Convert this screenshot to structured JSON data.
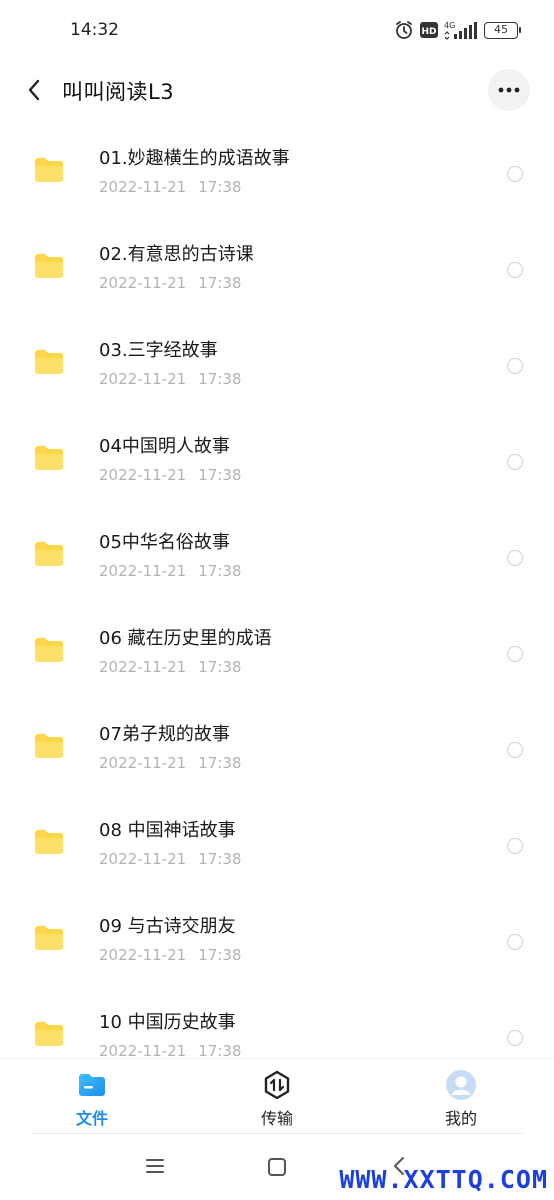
{
  "status_bar": {
    "time": "14:32",
    "network": "4G",
    "hd": "HD",
    "battery": "45"
  },
  "header": {
    "title": "叫叫阅读L3"
  },
  "files": [
    {
      "name": "01.妙趣横生的成语故事",
      "date": "2022-11-21",
      "time": "17:38"
    },
    {
      "name": "02.有意思的古诗课",
      "date": "2022-11-21",
      "time": "17:38"
    },
    {
      "name": "03.三字经故事",
      "date": "2022-11-21",
      "time": "17:38"
    },
    {
      "name": "04中国明人故事",
      "date": "2022-11-21",
      "time": "17:38"
    },
    {
      "name": "05中华名俗故事",
      "date": "2022-11-21",
      "time": "17:38"
    },
    {
      "name": "06 藏在历史里的成语",
      "date": "2022-11-21",
      "time": "17:38"
    },
    {
      "name": "07弟子规的故事",
      "date": "2022-11-21",
      "time": "17:38"
    },
    {
      "name": "08 中国神话故事",
      "date": "2022-11-21",
      "time": "17:38"
    },
    {
      "name": "09 与古诗交朋友",
      "date": "2022-11-21",
      "time": "17:38"
    },
    {
      "name": "10 中国历史故事",
      "date": "2022-11-21",
      "time": "17:38"
    }
  ],
  "bottom_nav": {
    "files_label": "文件",
    "transfer_label": "传输",
    "mine_label": "我的"
  },
  "watermark": "WWW.XXTTQ.COM",
  "colors": {
    "accent": "#1e8ee9",
    "folder": "#fdd64a",
    "date_text": "#b3b3b3"
  }
}
